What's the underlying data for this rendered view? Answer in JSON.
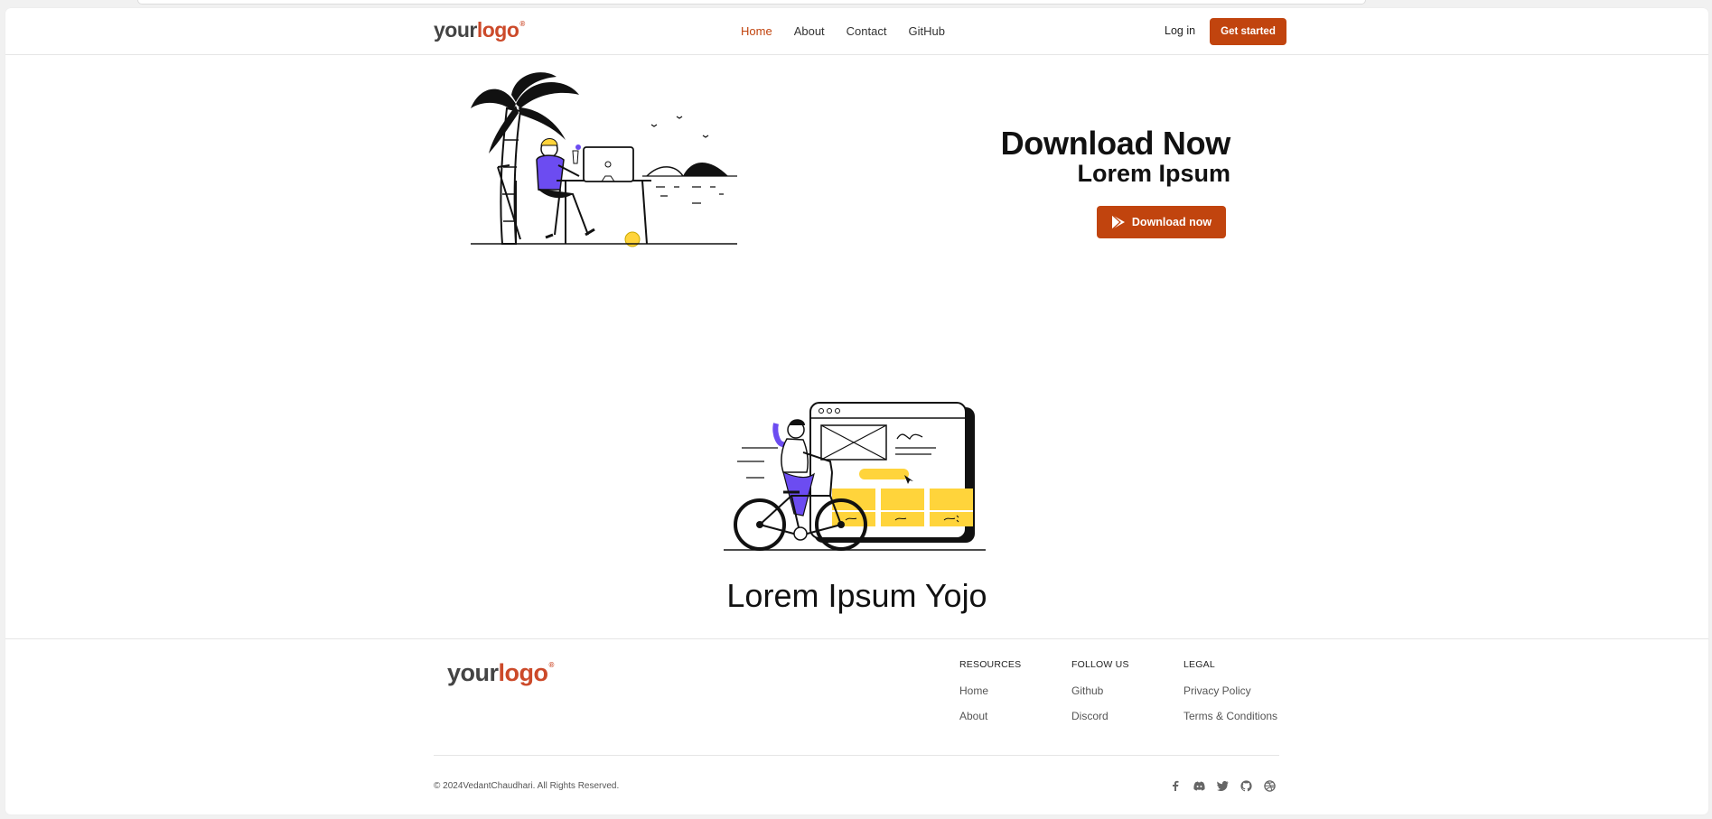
{
  "nav": {
    "logo": {
      "part1": "your",
      "part2": "logo",
      "mark": "®"
    },
    "links": [
      "Home",
      "About",
      "Contact",
      "GitHub"
    ],
    "login_label": "Log in",
    "cta_label": "Get started"
  },
  "hero": {
    "title": "Download Now",
    "subtitle": "Lorem Ipsum",
    "download_label": "Download now"
  },
  "section2": {
    "title": "Lorem Ipsum Yojo"
  },
  "footer": {
    "logo": {
      "part1": "your",
      "part2": "logo",
      "mark": "®"
    },
    "columns": [
      {
        "heading": "RESOURCES",
        "links": [
          "Home",
          "About"
        ]
      },
      {
        "heading": "FOLLOW US",
        "links": [
          "Github",
          "Discord"
        ]
      },
      {
        "heading": "LEGAL",
        "links": [
          "Privacy Policy",
          "Terms & Conditions"
        ]
      }
    ],
    "copyright": "© 2024VedantChaudhari. All Rights Reserved.",
    "social_icons": [
      "facebook-icon",
      "discord-icon",
      "twitter-icon",
      "github-icon",
      "dribbble-icon"
    ]
  },
  "colors": {
    "accent": "#c1440e",
    "logo_accent": "#cc4a2a",
    "illustration_purple": "#6c4cf1",
    "illustration_yellow": "#ffd43b"
  }
}
